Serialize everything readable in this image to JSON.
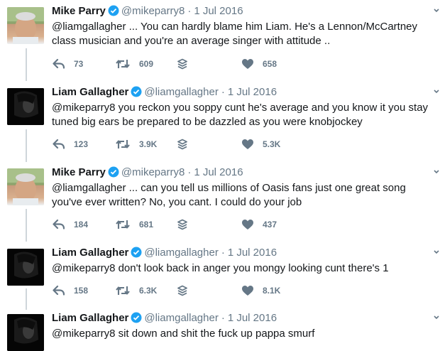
{
  "tweets": [
    {
      "name": "Mike Parry",
      "handle": "@mikeparry8",
      "separator": "·",
      "date": "1 Jul 2016",
      "text": "@liamgallagher ... You can hardly blame him Liam. He's a Lennon/McCartney class musician and you're an average singer with attitude ..",
      "replies": "73",
      "retweets": "609",
      "likes": "658",
      "avatar": "mike"
    },
    {
      "name": "Liam Gallagher",
      "handle": "@liamgallagher",
      "separator": "·",
      "date": "1 Jul 2016",
      "text": "@mikeparry8 you reckon you soppy cunt he's average and you know it you stay tuned big ears be prepared to be dazzled as you were knobjockey",
      "replies": "123",
      "retweets": "3.9K",
      "likes": "5.3K",
      "avatar": "liam"
    },
    {
      "name": "Mike Parry",
      "handle": "@mikeparry8",
      "separator": "·",
      "date": "1 Jul 2016",
      "text": "@liamgallagher ... can you tell us millions of Oasis fans just one great song you've ever written? No, you cant. I could do your job",
      "replies": "184",
      "retweets": "681",
      "likes": "437",
      "avatar": "mike"
    },
    {
      "name": "Liam Gallagher",
      "handle": "@liamgallagher",
      "separator": "·",
      "date": "1 Jul 2016",
      "text": "@mikeparry8 don't look back in anger you mongy looking cunt there's 1",
      "replies": "158",
      "retweets": "6.3K",
      "likes": "8.1K",
      "avatar": "liam"
    },
    {
      "name": "Liam Gallagher",
      "handle": "@liamgallagher",
      "separator": "·",
      "date": "1 Jul 2016",
      "text": "@mikeparry8 sit down and shit the fuck up pappa smurf",
      "replies": "",
      "retweets": "",
      "likes": "",
      "avatar": "liam"
    }
  ],
  "colors": {
    "verified": "#1da1f2",
    "muted": "#657786",
    "thread_line": "#cfd6db"
  },
  "icons": [
    "reply-icon",
    "retweet-icon",
    "stack-icon",
    "heart-icon",
    "verified-badge-icon",
    "caret-down-icon"
  ]
}
